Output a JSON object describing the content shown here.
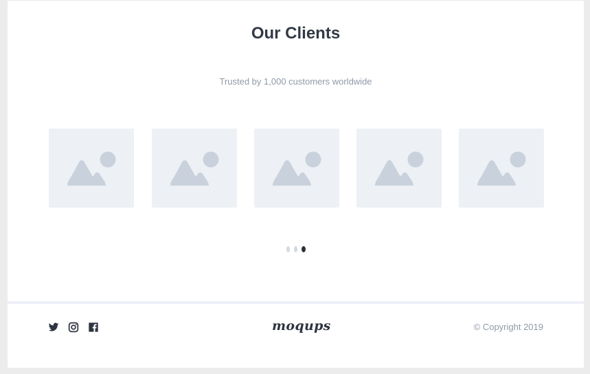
{
  "section": {
    "title": "Our Clients",
    "subtitle": "Trusted by 1,000 customers worldwide"
  },
  "client_logos": [
    {
      "icon": "image-placeholder-icon"
    },
    {
      "icon": "image-placeholder-icon"
    },
    {
      "icon": "image-placeholder-icon"
    },
    {
      "icon": "image-placeholder-icon"
    },
    {
      "icon": "image-placeholder-icon"
    }
  ],
  "carousel": {
    "page_count": 3,
    "active_index": 2
  },
  "footer": {
    "social_icons": [
      "twitter-icon",
      "instagram-icon",
      "facebook-icon"
    ],
    "brand": "moqups",
    "copyright": "© Copyright 2019"
  },
  "colors": {
    "title": "#333a45",
    "muted_text": "#8f9aa8",
    "placeholder_bg": "#edf0f4",
    "placeholder_shape": "#c9d2dc",
    "dot_inactive": "#d4d9df",
    "dot_active": "#2b303a",
    "divider": "#edf0f7"
  }
}
